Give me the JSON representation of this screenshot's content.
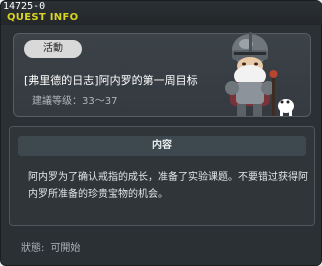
{
  "window": {
    "id_label": "14725-0",
    "title": "QUEST INFO"
  },
  "quest": {
    "badge": "活動",
    "title": "[弗里德的日志]阿内罗的第一周目标",
    "level": "建議等级：33～37",
    "npc_icon": "armored-knight-npc-icon"
  },
  "content": {
    "header": "内容",
    "text": "阿内罗为了确认戒指的成长，准备了实验课题。不要错过获得阿内罗所准备的珍贵宝物的机会。"
  },
  "status": {
    "label": "狀態:",
    "value": "可開始"
  },
  "colors": {
    "title_accent": "#d9d323",
    "window_bg": "#2b3034",
    "badge_bg": "#d9d9d9"
  }
}
